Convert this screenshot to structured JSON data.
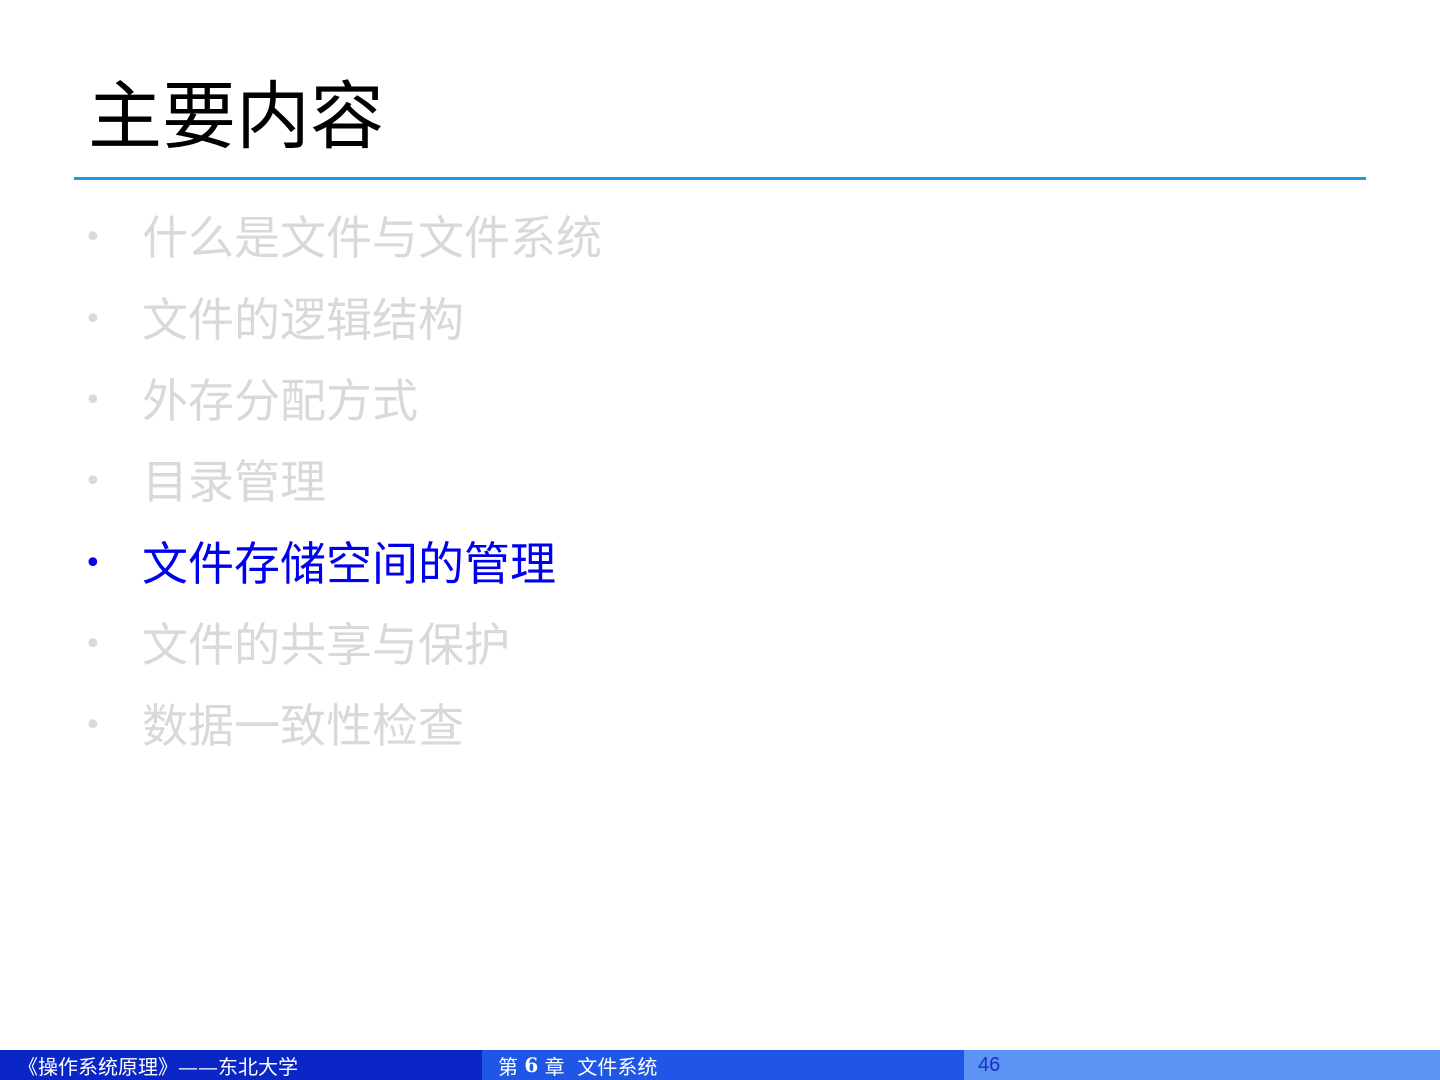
{
  "slide": {
    "title": "主要内容",
    "bullet_glyph": "•",
    "items": [
      {
        "label": "什么是文件与文件系统",
        "active": false
      },
      {
        "label": "文件的逻辑结构",
        "active": false
      },
      {
        "label": "外存分配方式",
        "active": false
      },
      {
        "label": "目录管理",
        "active": false
      },
      {
        "label": "文件存储空间的管理",
        "active": true
      },
      {
        "label": "文件的共享与保护",
        "active": false
      },
      {
        "label": "数据一致性检查",
        "active": false
      }
    ]
  },
  "colors": {
    "active_bullet": "#0000ee",
    "inactive_bullet": "#d9d9d9",
    "title_rule": "#1a9be8",
    "footer_left": "#0a26c6",
    "footer_mid": "#1f56e6",
    "footer_right": "#5c93f5"
  },
  "footer": {
    "course": "《操作系统原理》——东北大学",
    "chapter_prefix": "第",
    "chapter_number": "6",
    "chapter_suffix": "章  文件系统",
    "page_number": "46"
  }
}
